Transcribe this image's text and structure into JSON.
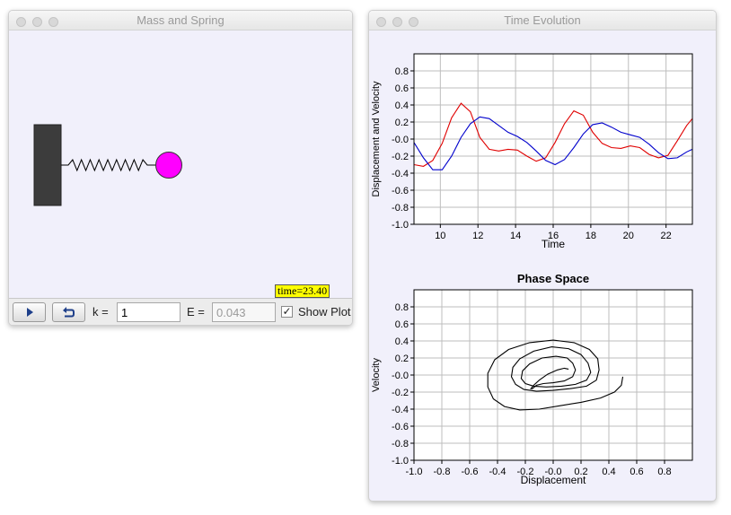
{
  "windows": {
    "mass_spring": {
      "title": "Mass and Spring",
      "time_label": "time=23.40",
      "controls": {
        "k_label": "k =",
        "k_value": "1",
        "e_label": "E =",
        "e_value": "0.043",
        "show_plot_label": "Show Plot",
        "show_plot_checked": true
      }
    },
    "time_evolution": {
      "title": "Time Evolution"
    }
  },
  "colors": {
    "mass": "#ff00ff",
    "wall": "#3c3c3c",
    "displacement_line": "#e00000",
    "velocity_line": "#0000cc",
    "phase_line": "#000000",
    "badge": "#ffff00"
  },
  "chart_data": [
    {
      "type": "line",
      "title": "",
      "xlabel": "Time",
      "ylabel": "Displacement and Velocity",
      "xlim": [
        8.6,
        23.4
      ],
      "ylim": [
        -1.0,
        1.0
      ],
      "xticks": [
        "10",
        "12",
        "14",
        "16",
        "18",
        "20",
        "22"
      ],
      "yticks": [
        "0.8",
        "0.6",
        "0.4",
        "0.2",
        "-0.0",
        "-0.2",
        "-0.4",
        "-0.6",
        "-0.8",
        "-1.0"
      ],
      "grid": true,
      "series": [
        {
          "color": "#e00000",
          "x": [
            8.6,
            9.1,
            9.6,
            10.1,
            10.6,
            11.1,
            11.6,
            12.1,
            12.6,
            13.1,
            13.6,
            14.1,
            14.6,
            15.1,
            15.6,
            16.1,
            16.6,
            17.1,
            17.6,
            18.1,
            18.6,
            19.1,
            19.6,
            20.1,
            20.6,
            21.1,
            21.6,
            22.1,
            22.6,
            23.1,
            23.4
          ],
          "y": [
            -0.3,
            -0.32,
            -0.25,
            -0.05,
            0.25,
            0.42,
            0.32,
            0.02,
            -0.12,
            -0.14,
            -0.12,
            -0.13,
            -0.2,
            -0.26,
            -0.22,
            -0.04,
            0.18,
            0.33,
            0.28,
            0.08,
            -0.05,
            -0.1,
            -0.11,
            -0.08,
            -0.1,
            -0.18,
            -0.22,
            -0.19,
            -0.02,
            0.16,
            0.24
          ]
        },
        {
          "color": "#0000cc",
          "x": [
            8.6,
            9.1,
            9.6,
            10.1,
            10.6,
            11.1,
            11.6,
            12.1,
            12.6,
            13.1,
            13.6,
            14.1,
            14.6,
            15.1,
            15.6,
            16.1,
            16.6,
            17.1,
            17.6,
            18.1,
            18.6,
            19.1,
            19.6,
            20.1,
            20.6,
            21.1,
            21.6,
            22.1,
            22.6,
            23.1,
            23.4
          ],
          "y": [
            -0.04,
            -0.22,
            -0.36,
            -0.36,
            -0.2,
            0.02,
            0.18,
            0.26,
            0.24,
            0.16,
            0.08,
            0.03,
            -0.04,
            -0.14,
            -0.25,
            -0.3,
            -0.24,
            -0.1,
            0.06,
            0.17,
            0.19,
            0.14,
            0.08,
            0.05,
            0.02,
            -0.06,
            -0.16,
            -0.23,
            -0.22,
            -0.15,
            -0.12
          ]
        }
      ]
    },
    {
      "type": "line",
      "title": "Phase Space",
      "xlabel": "Displacement",
      "ylabel": "Velocity",
      "xlim": [
        -1.0,
        1.0
      ],
      "ylim": [
        -1.0,
        1.0
      ],
      "xticks": [
        "-1.0",
        "-0.8",
        "-0.6",
        "-0.4",
        "-0.2",
        "-0.0",
        "0.2",
        "0.4",
        "0.6",
        "0.8"
      ],
      "yticks": [
        "0.8",
        "0.6",
        "0.4",
        "0.2",
        "-0.0",
        "-0.2",
        "-0.4",
        "-0.6",
        "-0.8",
        "-1.0"
      ],
      "grid": true,
      "series": [
        {
          "color": "#000000",
          "x": [
            0.5,
            0.49,
            0.44,
            0.34,
            0.2,
            0.05,
            -0.1,
            -0.24,
            -0.35,
            -0.43,
            -0.47,
            -0.47,
            -0.42,
            -0.32,
            -0.17,
            0.0,
            0.15,
            0.26,
            0.32,
            0.33,
            0.31,
            0.24,
            0.12,
            0.0,
            -0.12,
            -0.21,
            -0.27,
            -0.3,
            -0.29,
            -0.24,
            -0.14,
            -0.01,
            0.11,
            0.2,
            0.25,
            0.27,
            0.24,
            0.16,
            0.06,
            -0.05,
            -0.14,
            -0.2,
            -0.23,
            -0.22,
            -0.17,
            -0.08,
            0.02,
            0.1,
            0.14,
            0.16,
            0.14,
            0.08,
            0.0,
            -0.07,
            -0.12,
            -0.15,
            -0.16,
            -0.14,
            -0.1,
            -0.04,
            0.03,
            0.08,
            0.11
          ],
          "y": [
            -0.02,
            -0.12,
            -0.2,
            -0.27,
            -0.32,
            -0.36,
            -0.4,
            -0.41,
            -0.37,
            -0.28,
            -0.14,
            0.02,
            0.18,
            0.3,
            0.38,
            0.41,
            0.38,
            0.3,
            0.19,
            0.06,
            -0.06,
            -0.13,
            -0.16,
            -0.18,
            -0.19,
            -0.17,
            -0.11,
            -0.02,
            0.09,
            0.19,
            0.28,
            0.33,
            0.31,
            0.24,
            0.14,
            0.03,
            -0.06,
            -0.11,
            -0.13,
            -0.14,
            -0.13,
            -0.1,
            -0.04,
            0.05,
            0.13,
            0.2,
            0.22,
            0.2,
            0.14,
            0.06,
            -0.02,
            -0.07,
            -0.09,
            -0.1,
            -0.12,
            -0.16,
            -0.16,
            -0.12,
            -0.06,
            0.01,
            0.06,
            0.08,
            0.07
          ]
        }
      ]
    }
  ]
}
